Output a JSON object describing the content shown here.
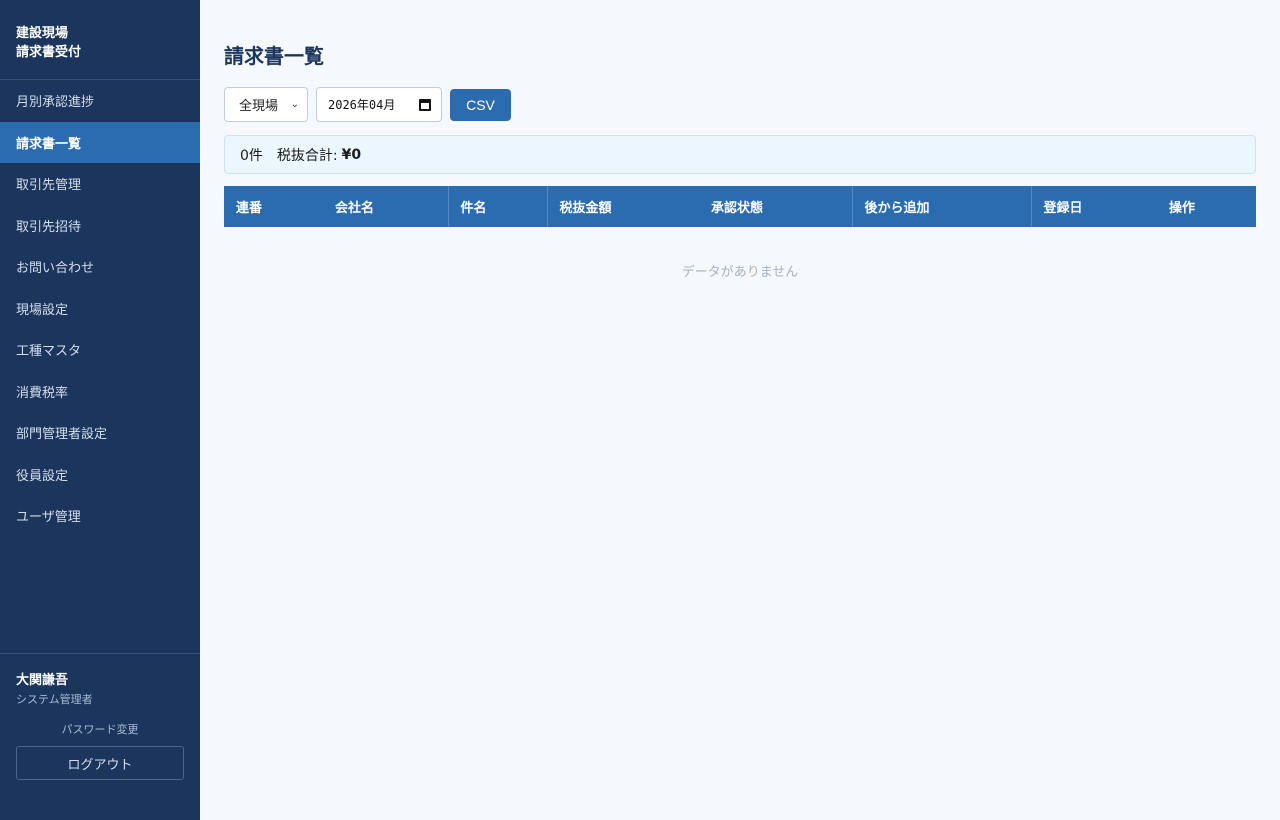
{
  "brand": {
    "line1": "建設現場",
    "line2": "請求書受付"
  },
  "nav": {
    "items": [
      {
        "label": "月別承認進捗"
      },
      {
        "label": "請求書一覧"
      },
      {
        "label": "取引先管理"
      },
      {
        "label": "取引先招待"
      },
      {
        "label": "お問い合わせ"
      },
      {
        "label": "現場設定"
      },
      {
        "label": "工種マスタ"
      },
      {
        "label": "消費税率"
      },
      {
        "label": "部門管理者設定"
      },
      {
        "label": "役員設定"
      },
      {
        "label": "ユーザ管理"
      }
    ],
    "active": "請求書一覧"
  },
  "user": {
    "name": "大関謙吾",
    "role": "システム管理者",
    "password_link": "パスワード変更",
    "logout_label": "ログアウト"
  },
  "main": {
    "title": "請求書一覧",
    "filters": {
      "site_select": "全現場",
      "month": "2026年04月",
      "csv_label": "CSV"
    },
    "summary": {
      "count": "0件",
      "total_label": "税抜合計:",
      "total_value": "¥0"
    },
    "table": {
      "headers": [
        "連番",
        "会社名",
        "件名",
        "税抜金額",
        "承認状態",
        "後から追加",
        "登録日",
        "操作"
      ],
      "empty_message": "データがありません"
    }
  },
  "colors": {
    "sidebar_bg": "#1b355c",
    "accent": "#2b6cb0",
    "summary_bg": "#ebf6fe"
  }
}
